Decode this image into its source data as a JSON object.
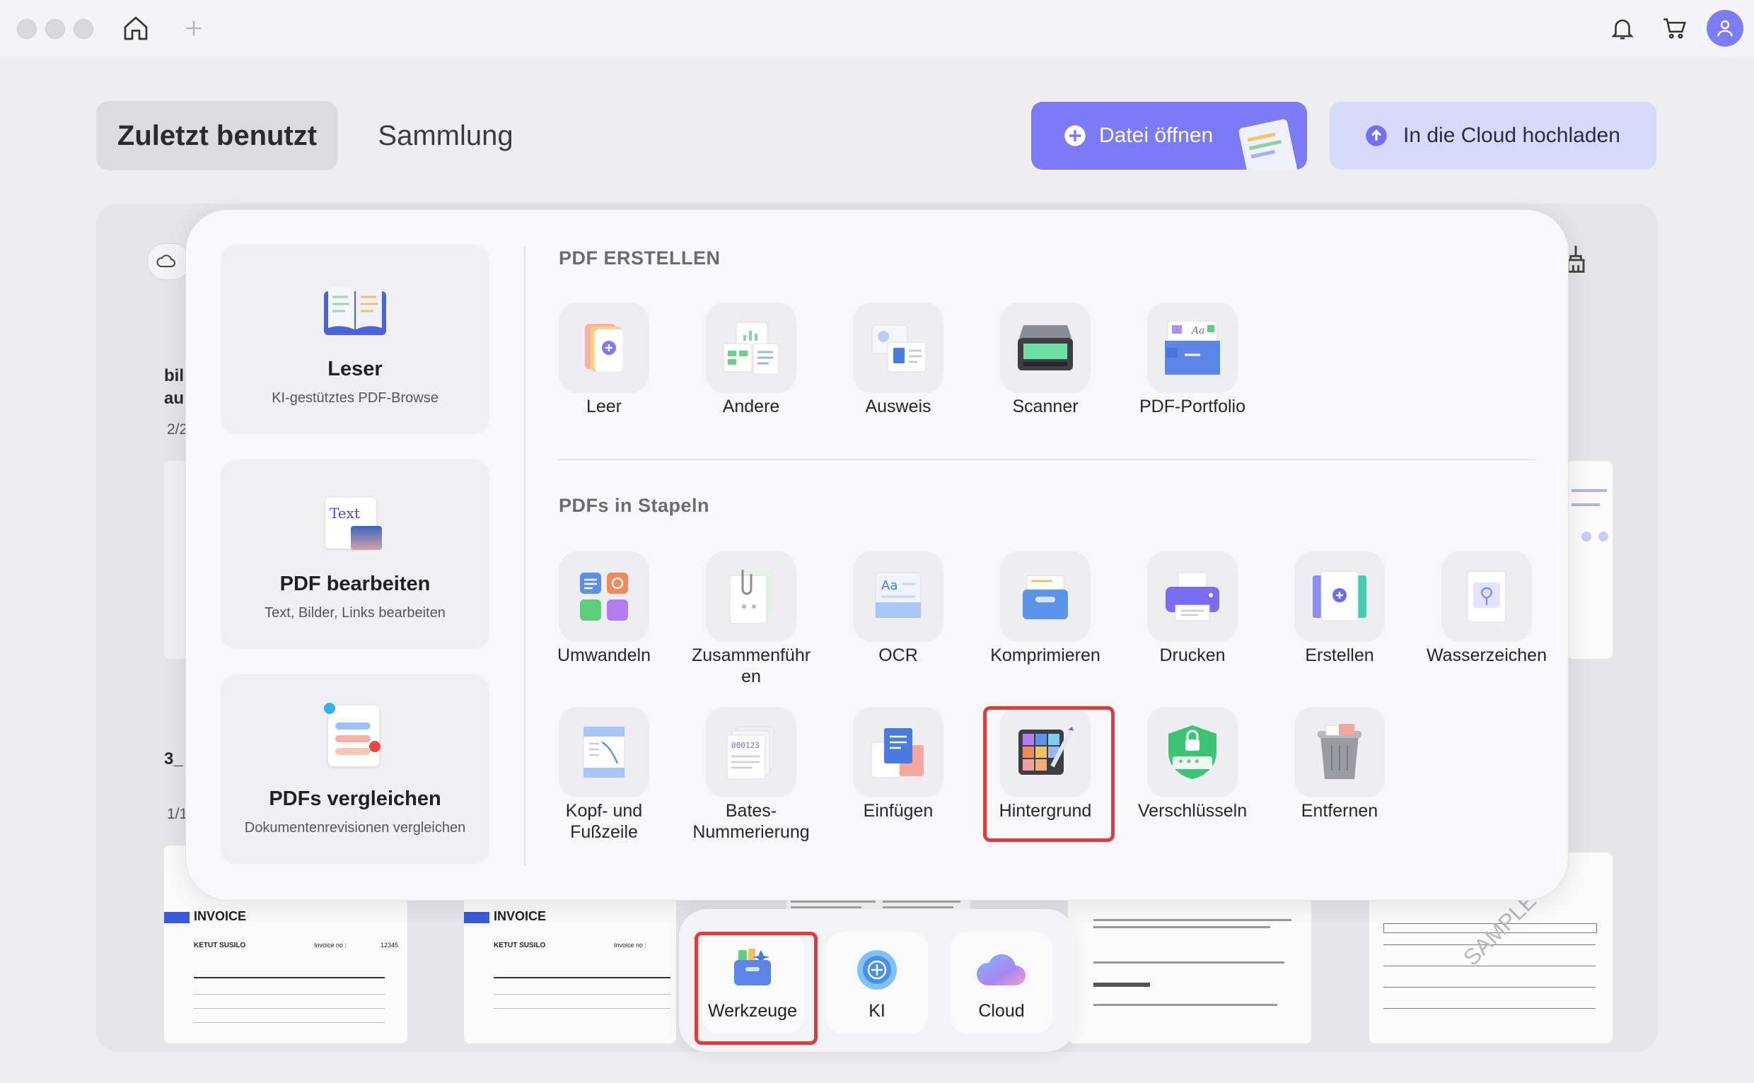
{
  "header": {
    "tabs": [
      "Zuletzt benutzt",
      "Sammlung"
    ],
    "open_button": "Datei öffnen",
    "cloud_button": "In die Cloud hochladen"
  },
  "left_cards": [
    {
      "title": "Leser",
      "subtitle": "KI-gestütztes PDF-Browse"
    },
    {
      "title": "PDF bearbeiten",
      "subtitle": "Text, Bilder, Links bearbeiten",
      "icon_text": "Text"
    },
    {
      "title": "PDFs vergleichen",
      "subtitle": "Dokumentenrevisionen vergleichen"
    }
  ],
  "sections": {
    "create": "PDF ERSTELLEN",
    "batch": "PDFs in Stapeln"
  },
  "create_tools": [
    "Leer",
    "Andere",
    "Ausweis",
    "Scanner",
    "PDF-Portfolio"
  ],
  "batch_tools_row1": [
    "Umwandeln",
    "Zusammenführen",
    "OCR",
    "Komprimieren",
    "Drucken",
    "Erstellen",
    "Wasserzeichen"
  ],
  "batch_tools_row2": [
    "Kopf- und Fußzeile",
    "Bates-Nummerierung",
    "Einfügen",
    "Hintergrund",
    "Verschlüsseln",
    "Entfernen"
  ],
  "dock": [
    "Werkzeuge",
    "KI",
    "Cloud"
  ],
  "background_files": {
    "file1_name": "bil au",
    "file1_pages": "2/2",
    "file2_name": "3_",
    "file2_pages": "1/1",
    "invoice_title": "INVOICE",
    "invoice_to": "KETUT SUSILO",
    "invoice_no_label": "Invoice no :",
    "invoice_no": "12345",
    "watermark": "SAMPLE"
  },
  "colors": {
    "accent": "#7c7bf6",
    "highlight": "#e23b3b"
  }
}
